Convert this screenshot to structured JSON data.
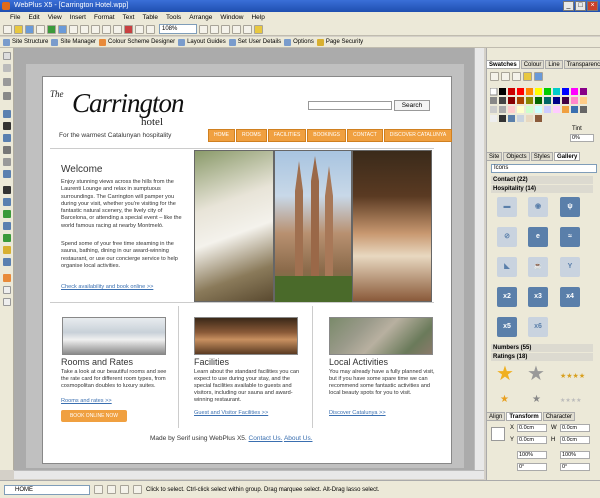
{
  "window": {
    "title": "WebPlus X5 - [Carrington Hotel.wpp]"
  },
  "menu": [
    "File",
    "Edit",
    "View",
    "Insert",
    "Format",
    "Text",
    "Table",
    "Tools",
    "Arrange",
    "Window",
    "Help"
  ],
  "toolbar": {
    "zoom": "108%"
  },
  "context_toolbar": [
    "Site Structure",
    "Site Manager",
    "Colour Scheme Designer",
    "Layout Guides",
    "Set User Details",
    "Options",
    "Page Security"
  ],
  "site": {
    "logo_the": "The",
    "logo_name": "Carrington",
    "logo_hotel": "hotel",
    "tagline": "For the warmest Catalunyan hospitality",
    "search_button": "Search",
    "nav": [
      "HOME",
      "ROOMS",
      "FACILITIES",
      "BOOKINGS",
      "CONTACT",
      "DISCOVER CATALUNYA"
    ],
    "welcome_title": "Welcome",
    "welcome_p1": "Enjoy stunning views across the hills from the Laurenti Lounge and relax in sumptuous surroundings. The Carrington will pamper you during your visit, whether you're visiting for the fantastic natural scenery, the lively city of Barcelona, or attending a special event – like the world famous racing at nearby Montmeló.",
    "welcome_p2": "Spend some of your free time steaming in the sauna, bathing, dining in our award-winning restaurant, or use our concierge service to help organise local activities.",
    "availability_link": "Check availability and book online >>",
    "rooms_title": "Rooms and Rates",
    "rooms_text": "Take a look at our beautiful rooms and see the rate card for different room types, from cosmopolitan doubles to luxury suites.",
    "rooms_link": "Rooms and rates >>",
    "book_button": "BOOK ONLINE NOW",
    "facilities_title": "Facilities",
    "facilities_text": "Learn about the standard facilities you can expect to use during your stay, and the special facilities available to guests and visitors, including our sauna and award-winning restaurant.",
    "facilities_link": "Guest and Visitor Facilities >>",
    "local_title": "Local Activities",
    "local_text": "You may already have a fully planned visit, but if you have some spare time we can recommend some fantastic activities and local beauty spots for you to visit.",
    "local_link": "Discover Catalunya >>",
    "footer_text": "Made by Serif using WebPlus X5.",
    "footer_contact": "Contact Us.",
    "footer_about": "About Us."
  },
  "panel": {
    "top_tabs": [
      "Swatches",
      "Colour",
      "Line",
      "Transparency"
    ],
    "tint_label": "Tint",
    "tint_value": "0%",
    "mid_tabs": [
      "Site",
      "Objects",
      "Styles",
      "Gallery"
    ],
    "gallery_select": "Icons",
    "cat_contact": "Contact (22)",
    "cat_hospitality": "Hospitality (14)",
    "cat_numbers": "Numbers (55)",
    "cat_ratings": "Ratings (18)",
    "icon_labels": [
      "x2",
      "x3",
      "x4",
      "x5",
      "x6"
    ],
    "bottom_tabs": [
      "Align",
      "Transform",
      "Character"
    ],
    "transform": {
      "x": "0.0cm",
      "y": "0.0cm",
      "w": "0.0cm",
      "h": "0.0cm",
      "sx": "100%",
      "sy": "100%",
      "rot": "0°",
      "shear": "0°"
    }
  },
  "status": {
    "page": "HOME",
    "hint": "Click to select. Ctrl-click select within group. Drag marquee select. Alt-Drag lasso select."
  },
  "colors": {
    "accent": "#f0a040",
    "link": "#3a6fb0",
    "titlebar": "#2556c4"
  }
}
